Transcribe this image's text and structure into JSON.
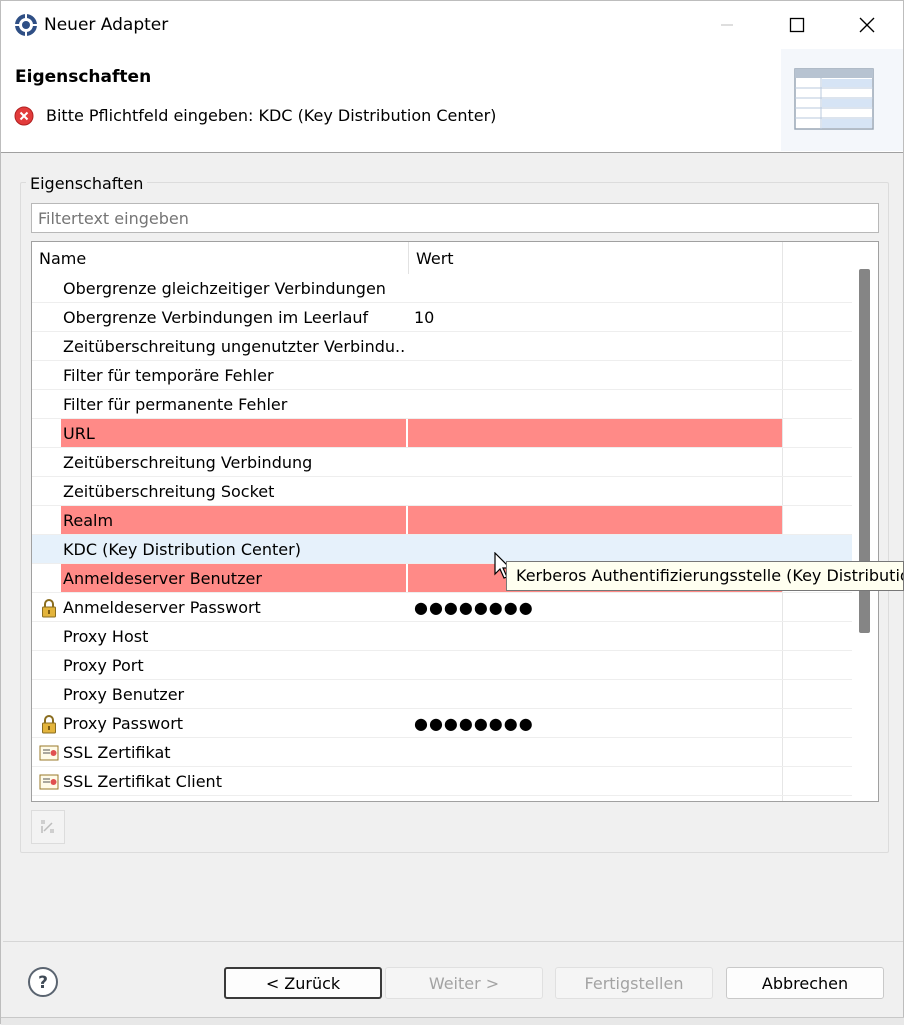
{
  "window": {
    "title": "Neuer Adapter"
  },
  "header": {
    "title": "Eigenschaften",
    "message": "Bitte Pflichtfeld eingeben: KDC (Key Distribution Center)"
  },
  "group": {
    "label": "Eigenschaften",
    "filter_placeholder": "Filtertext eingeben"
  },
  "table": {
    "columns": [
      "Name",
      "Wert"
    ],
    "rows": [
      {
        "name": "Obergrenze gleichzeitiger Verbindungen",
        "value": "",
        "required": false,
        "icon": ""
      },
      {
        "name": "Obergrenze Verbindungen im Leerlauf",
        "value": "10",
        "required": false,
        "icon": ""
      },
      {
        "name": "Zeitüberschreitung ungenutzter Verbindu...",
        "value": "",
        "required": false,
        "icon": ""
      },
      {
        "name": "Filter für temporäre Fehler",
        "value": "",
        "required": false,
        "icon": ""
      },
      {
        "name": "Filter für permanente Fehler",
        "value": "",
        "required": false,
        "icon": ""
      },
      {
        "name": "URL",
        "value": "",
        "required": true,
        "icon": ""
      },
      {
        "name": "Zeitüberschreitung Verbindung",
        "value": "",
        "required": false,
        "icon": ""
      },
      {
        "name": "Zeitüberschreitung Socket",
        "value": "",
        "required": false,
        "icon": ""
      },
      {
        "name": "Realm",
        "value": "",
        "required": true,
        "icon": ""
      },
      {
        "name": "KDC (Key Distribution Center)",
        "value": "",
        "required": false,
        "selected": true,
        "icon": ""
      },
      {
        "name": "Anmeldeserver Benutzer",
        "value": "",
        "required": true,
        "icon": ""
      },
      {
        "name": "Anmeldeserver Passwort",
        "value": "●●●●●●●●",
        "required": false,
        "icon": "lock-icon"
      },
      {
        "name": "Proxy Host",
        "value": "",
        "required": false,
        "icon": ""
      },
      {
        "name": "Proxy Port",
        "value": "",
        "required": false,
        "icon": ""
      },
      {
        "name": "Proxy Benutzer",
        "value": "",
        "required": false,
        "icon": ""
      },
      {
        "name": "Proxy Passwort",
        "value": "●●●●●●●●",
        "required": false,
        "icon": "lock-icon"
      },
      {
        "name": "SSL Zertifikat",
        "value": "",
        "required": false,
        "icon": "certificate-icon"
      },
      {
        "name": "SSL Zertifikat Client",
        "value": "",
        "required": false,
        "icon": "certificate-icon"
      }
    ]
  },
  "tooltip": {
    "text": "Kerberos Authentifizierungsstelle (Key Distribution"
  },
  "buttons": {
    "back": "< Zurück",
    "next": "Weiter >",
    "finish": "Fertigstellen",
    "cancel": "Abbrechen"
  },
  "colors": {
    "required_row": "#ff8a87",
    "selected_row": "#e6f1fb",
    "tooltip_bg": "#fffff0"
  }
}
